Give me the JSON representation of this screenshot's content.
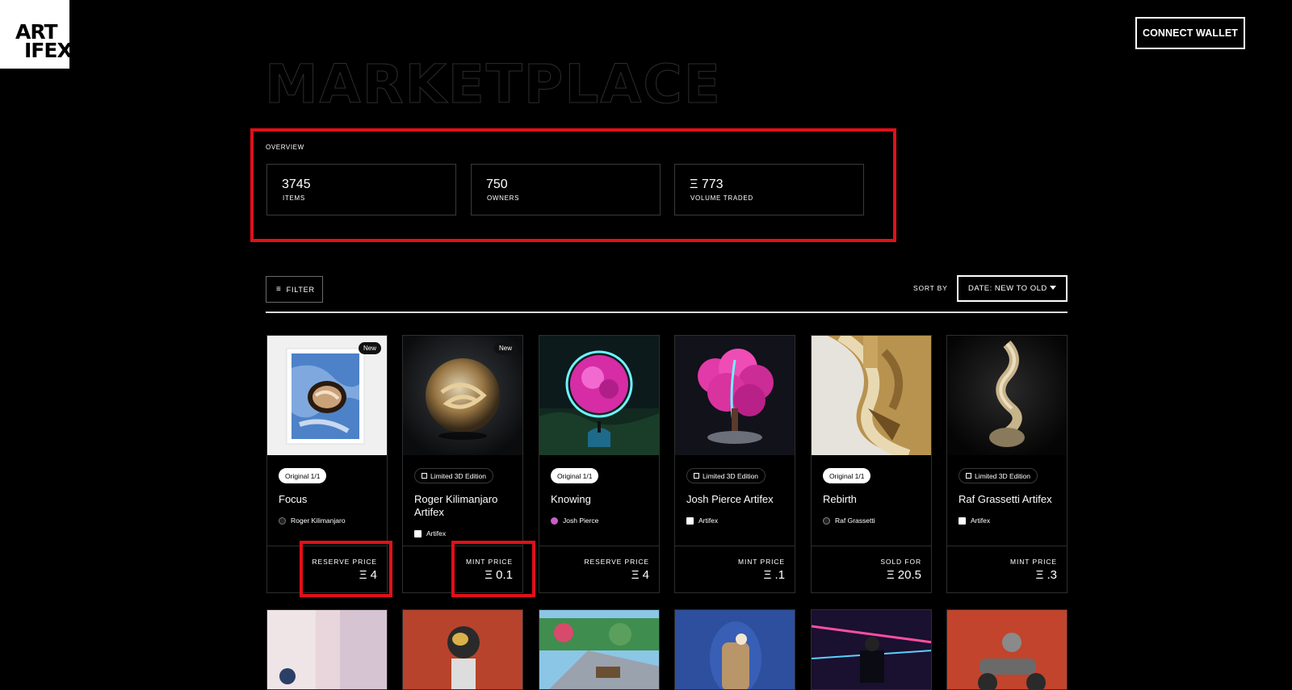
{
  "logo": {
    "line1": "ART",
    "line2": "IFEX"
  },
  "header": {
    "connect_label": "CONNECT WALLET"
  },
  "page": {
    "title": "MARKETPLACE"
  },
  "overview": {
    "label": "OVERVIEW",
    "stats": [
      {
        "value": "3745",
        "label": "ITEMS"
      },
      {
        "value": "750",
        "label": "OWNERS"
      },
      {
        "value": "Ξ 773",
        "label": "VOLUME TRADED"
      }
    ]
  },
  "controls": {
    "filter_label": "FILTER",
    "sort_by_label": "SORT BY",
    "sort_value": "DATE: NEW TO OLD"
  },
  "cards": [
    {
      "badge": "New",
      "tag": "Original 1/1",
      "name": "Focus",
      "artist": "Roger Kilimanjaro",
      "price_label": "RESERVE PRICE",
      "price": "Ξ 4"
    },
    {
      "badge": "New",
      "tag": "Limited 3D Edition",
      "name": "Roger Kilimanjaro Artifex",
      "artist": "Artifex",
      "price_label": "MINT PRICE",
      "price": "Ξ 0.1"
    },
    {
      "badge": "",
      "tag": "Original 1/1",
      "name": "Knowing",
      "artist": "Josh Pierce",
      "price_label": "RESERVE PRICE",
      "price": "Ξ 4"
    },
    {
      "badge": "",
      "tag": "Limited 3D Edition",
      "name": "Josh Pierce Artifex",
      "artist": "Artifex",
      "price_label": "MINT PRICE",
      "price": "Ξ .1"
    },
    {
      "badge": "",
      "tag": "Original 1/1",
      "name": "Rebirth",
      "artist": "Raf Grassetti",
      "price_label": "SOLD FOR",
      "price": "Ξ 20.5"
    },
    {
      "badge": "",
      "tag": "Limited 3D Edition",
      "name": "Raf Grassetti Artifex",
      "artist": "Artifex",
      "price_label": "MINT PRICE",
      "price": "Ξ .3"
    }
  ],
  "colors": {
    "highlight": "#e0101a",
    "background": "#000000",
    "text": "#ffffff"
  }
}
